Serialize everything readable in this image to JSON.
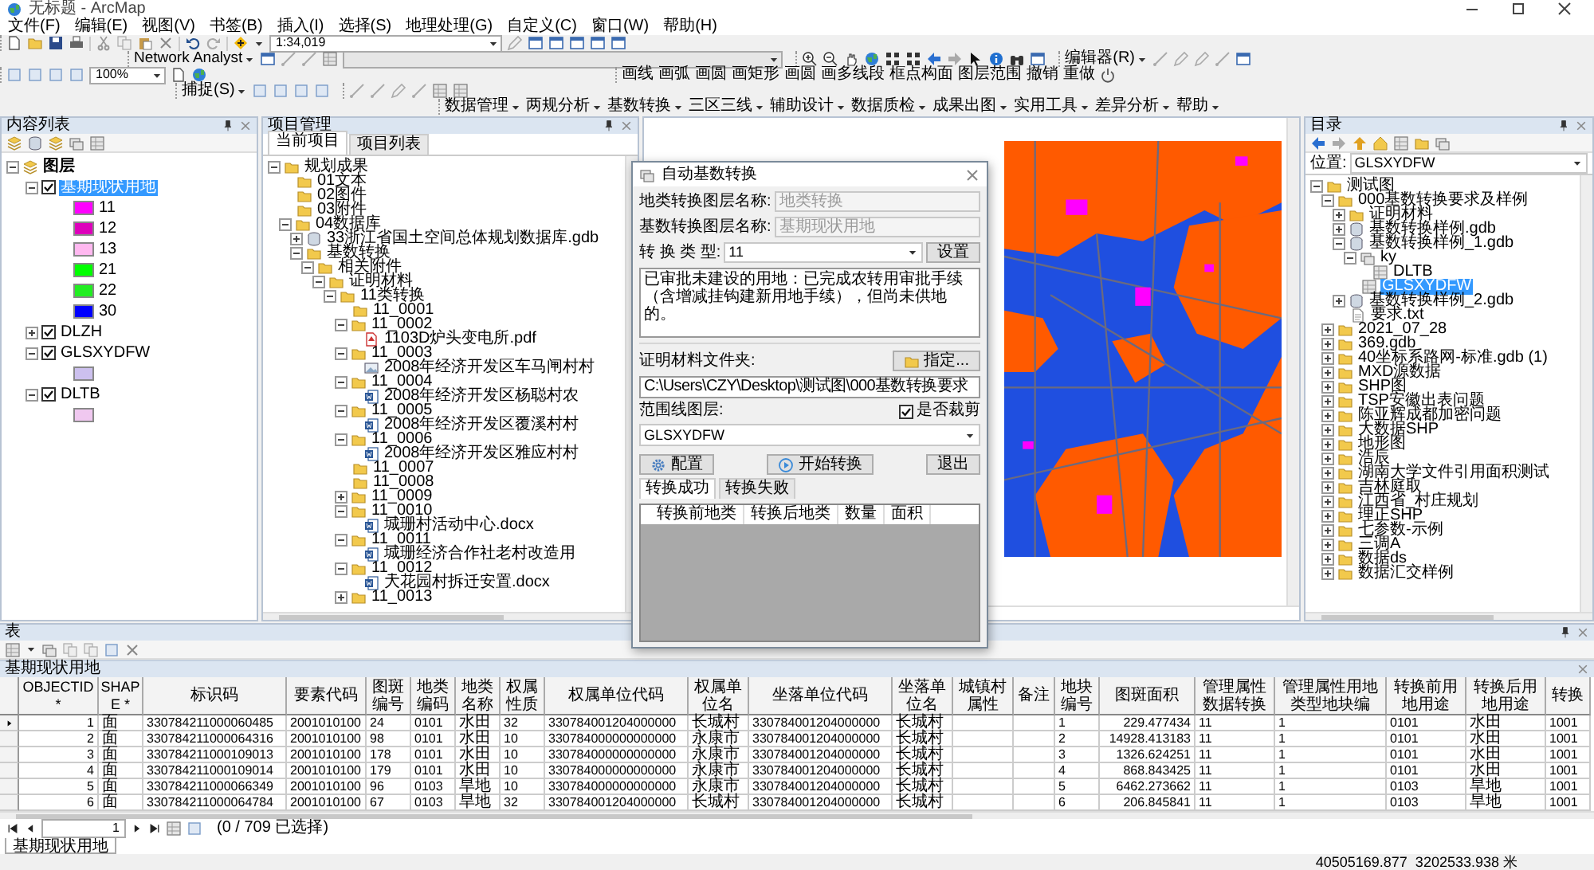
{
  "window": {
    "title": "无标题 - ArcMap"
  },
  "menu": [
    "文件(F)",
    "编辑(E)",
    "视图(V)",
    "书签(B)",
    "插入(I)",
    "选择(S)",
    "地理处理(G)",
    "自定义(C)",
    "窗口(W)",
    "帮助(H)"
  ],
  "toolbars": {
    "scale": "1:34,019",
    "network_analyst": "Network Analyst",
    "editor": "编辑器(R)",
    "zoom_percent": "100%",
    "snapping": "捕捉(S)",
    "draw_tools": [
      "画线",
      "画弧",
      "画圆",
      "画矩形",
      "画圆",
      "画多线段",
      "框点构面",
      "图层范围",
      "撤销",
      "重做"
    ],
    "plugin_menus": [
      "数据管理",
      "两规分析",
      "基数转换",
      "三区三线",
      "辅助设计",
      "数据质检",
      "成果出图",
      "实用工具",
      "差异分析",
      "帮助"
    ]
  },
  "toc": {
    "title": "内容列表",
    "layers": [
      {
        "label": "图层",
        "kind": "group",
        "expanded": true,
        "children": [
          {
            "label": "基期现状用地",
            "checked": true,
            "selected": true,
            "expanded": true,
            "legend": [
              {
                "label": "11",
                "color": "#ff00ff"
              },
              {
                "label": "12",
                "color": "#dd00bb"
              },
              {
                "label": "13",
                "color": "#ffb8f0"
              },
              {
                "label": "21",
                "color": "#00ff00"
              },
              {
                "label": "22",
                "color": "#22ee22"
              },
              {
                "label": "30",
                "color": "#0000ff"
              }
            ]
          },
          {
            "label": "DLZH",
            "checked": true,
            "selected": false,
            "expanded": false
          },
          {
            "label": "GLSXYDFW",
            "checked": true,
            "selected": false,
            "expanded": true,
            "legend": [
              {
                "color": "#ccc0ee"
              }
            ]
          },
          {
            "label": "DLTB",
            "checked": true,
            "selected": false,
            "expanded": true,
            "legend": [
              {
                "color": "#f0c8f0"
              }
            ]
          }
        ]
      }
    ]
  },
  "project": {
    "title": "项目管理",
    "tabs": [
      {
        "label": "当前项目",
        "selected": true
      },
      {
        "label": "项目列表",
        "selected": false
      }
    ],
    "tree": [
      {
        "label": "规划成果",
        "kind": "folder",
        "expanded": true,
        "children": [
          {
            "label": "01文本",
            "kind": "folder"
          },
          {
            "label": "02图件",
            "kind": "folder"
          },
          {
            "label": "03附件",
            "kind": "folder"
          },
          {
            "label": "04数据库",
            "kind": "folder",
            "expanded": true,
            "children": [
              {
                "label": "33浙江省国土空间总体规划数据库.gdb",
                "kind": "gdb",
                "expanded": false
              },
              {
                "label": "基数转换",
                "kind": "folder",
                "expanded": true,
                "children": [
                  {
                    "label": "相关附件",
                    "kind": "folder",
                    "expanded": true,
                    "children": [
                      {
                        "label": "证明材料",
                        "kind": "folder",
                        "expanded": true,
                        "children": [
                          {
                            "label": "11类转换",
                            "kind": "folder",
                            "expanded": true,
                            "children": [
                              {
                                "label": "11_0001",
                                "kind": "folder"
                              },
                              {
                                "label": "11_0002",
                                "kind": "folder",
                                "expanded": true,
                                "children": [
                                  {
                                    "label": "1103D炉头变电所.pdf",
                                    "kind": "pdf"
                                  }
                                ]
                              },
                              {
                                "label": "11_0003",
                                "kind": "folder",
                                "expanded": true,
                                "children": [
                                  {
                                    "label": "2008年经济开发区车马闸村村",
                                    "kind": "image"
                                  }
                                ]
                              },
                              {
                                "label": "11_0004",
                                "kind": "folder",
                                "expanded": true,
                                "children": [
                                  {
                                    "label": "2008年经济开发区杨聪村农",
                                    "kind": "docx"
                                  }
                                ]
                              },
                              {
                                "label": "11_0005",
                                "kind": "folder",
                                "expanded": true,
                                "children": [
                                  {
                                    "label": "2008年经济开发区覆溪村村",
                                    "kind": "docx"
                                  }
                                ]
                              },
                              {
                                "label": "11_0006",
                                "kind": "folder",
                                "expanded": true,
                                "children": [
                                  {
                                    "label": "2008年经济开发区雅应村村",
                                    "kind": "docx"
                                  }
                                ]
                              },
                              {
                                "label": "11_0007",
                                "kind": "folder"
                              },
                              {
                                "label": "11_0008",
                                "kind": "folder"
                              },
                              {
                                "label": "11_0009",
                                "kind": "folder",
                                "expanded": false
                              },
                              {
                                "label": "11_0010",
                                "kind": "folder",
                                "expanded": true,
                                "children": [
                                  {
                                    "label": "城珊村活动中心.docx",
                                    "kind": "docx"
                                  }
                                ]
                              },
                              {
                                "label": "11_0011",
                                "kind": "folder",
                                "expanded": true,
                                "children": [
                                  {
                                    "label": "城珊经济合作社老村改造用",
                                    "kind": "docx"
                                  }
                                ]
                              },
                              {
                                "label": "11_0012",
                                "kind": "folder",
                                "expanded": true,
                                "children": [
                                  {
                                    "label": "大花园村拆迁安置.docx",
                                    "kind": "docx"
                                  }
                                ]
                              },
                              {
                                "label": "11_0013",
                                "kind": "folder",
                                "expanded": false
                              }
                            ]
                          }
                        ]
                      }
                    ]
                  }
                ]
              }
            ]
          }
        ]
      }
    ]
  },
  "dialog": {
    "title": "自动基数转换",
    "fields": [
      {
        "label": "地类转换图层名称:",
        "value": "地类转换",
        "disabled": true
      },
      {
        "label": "基数转换图层名称:",
        "value": "基期现状用地",
        "disabled": true
      }
    ],
    "type_label": "转 换 类 型:",
    "type_value": "11",
    "settings_button": "设置",
    "description": "已审批未建设的用地：已完成农转用审批手续（含增减挂钩建新用地手续），但尚未供地的。",
    "evidence_label": "证明材料文件夹:",
    "browse_button": "指定...",
    "evidence_path": "C:\\Users\\CZY\\Desktop\\测试图\\000基数转换要求",
    "extent_label": "范围线图层:",
    "clip": {
      "label": "是否裁剪",
      "checked": true
    },
    "extent_layer": "GLSXYDFW",
    "buttons": [
      {
        "label": "配置",
        "kind": "config"
      },
      {
        "label": "开始转换",
        "kind": "start"
      },
      {
        "label": "退出",
        "kind": "exit"
      }
    ],
    "tabs": [
      {
        "label": "转换成功",
        "selected": true
      },
      {
        "label": "转换失败",
        "selected": false
      }
    ],
    "grid_columns": [
      "转换前地类",
      "转换后地类",
      "数量",
      "面积"
    ]
  },
  "catalog": {
    "title": "目录",
    "location_label": "位置:",
    "location": "GLSXYDFW",
    "tree": [
      {
        "label": "测试图",
        "kind": "folder",
        "expanded": true,
        "selected": false,
        "children": [
          {
            "label": "000基数转换要求及样例",
            "kind": "folder",
            "expanded": true,
            "selected": false,
            "children": [
              {
                "label": "证明材料",
                "kind": "folder",
                "expanded": false,
                "selected": false
              },
              {
                "label": "基数转换样例.gdb",
                "kind": "gdb",
                "expanded": false,
                "selected": false
              },
              {
                "label": "基数转换样例_1.gdb",
                "kind": "gdb",
                "expanded": true,
                "selected": false,
                "children": [
                  {
                    "label": "ky",
                    "kind": "dataset",
                    "expanded": true,
                    "selected": false,
                    "children": [
                      {
                        "label": "DLTB",
                        "kind": "featureclass",
                        "selected": false
                      }
                    ]
                  },
                  {
                    "label": "GLSXYDFW",
                    "kind": "featureclass",
                    "selected": true
                  }
                ]
              },
              {
                "label": "基数转换样例_2.gdb",
                "kind": "gdb",
                "expanded": false,
                "selected": false
              },
              {
                "label": "要求.txt",
                "kind": "txt",
                "selected": false
              }
            ]
          },
          {
            "label": "2021_07_28",
            "kind": "folder",
            "expanded": false,
            "selected": false
          },
          {
            "label": "369.gdb",
            "kind": "folder",
            "expanded": false,
            "selected": false
          },
          {
            "label": "40坐标系路网-标准.gdb (1)",
            "kind": "folder",
            "expanded": false,
            "selected": false
          },
          {
            "label": "MXD源数据",
            "kind": "folder",
            "expanded": false,
            "selected": false
          },
          {
            "label": "SHP图",
            "kind": "folder",
            "expanded": false,
            "selected": false
          },
          {
            "label": "TSP安徽出表问题",
            "kind": "folder",
            "expanded": false,
            "selected": false
          },
          {
            "label": "陈亚辉成都加密问题",
            "kind": "folder",
            "expanded": false,
            "selected": false
          },
          {
            "label": "大数据SHP",
            "kind": "folder",
            "expanded": false,
            "selected": false
          },
          {
            "label": "地形图",
            "kind": "folder",
            "expanded": false,
            "selected": false
          },
          {
            "label": "浩辰",
            "kind": "folder",
            "expanded": false,
            "selected": false
          },
          {
            "label": "湖南大学文件引用面积测试",
            "kind": "folder",
            "expanded": false,
            "selected": false
          },
          {
            "label": "吉林庭取",
            "kind": "folder",
            "expanded": false,
            "selected": false
          },
          {
            "label": "江西省_村庄规划",
            "kind": "folder",
            "expanded": false,
            "selected": false
          },
          {
            "label": "理正SHP",
            "kind": "folder",
            "expanded": false,
            "selected": false
          },
          {
            "label": "七参数-示例",
            "kind": "folder",
            "expanded": false,
            "selected": false
          },
          {
            "label": "三调A",
            "kind": "folder",
            "expanded": false,
            "selected": false
          },
          {
            "label": "数据ds",
            "kind": "folder",
            "expanded": false,
            "selected": false
          },
          {
            "label": "数据汇交样例",
            "kind": "folder",
            "expanded": false,
            "selected": false
          }
        ]
      }
    ]
  },
  "table": {
    "title": "表",
    "layer_tab": "基期现状用地",
    "columns": [
      "OBJECTID *",
      "SHAPE *",
      "标识码",
      "要素代码",
      "图斑编号",
      "地类编码",
      "地类名称",
      "权属性质",
      "权属单位代码",
      "权属单位名",
      "坐落单位代码",
      "坐落单位名",
      "城镇村属性",
      "备注",
      "地块编号",
      "图斑面积",
      "管理属性数据转换",
      "管理属性用地类型地块编",
      "转换前用地用途",
      "转换后用地用途",
      "转换"
    ],
    "rows": [
      {
        "current": true,
        "cells": [
          "1",
          "面",
          "330784211000060485",
          "2001010100",
          "24",
          "0101",
          "水田",
          "32",
          "330784001204000000",
          "长城村",
          "330784001204000000",
          "长城村",
          null,
          null,
          "1",
          "229.477434",
          "11",
          "1",
          "0101",
          "水田",
          "1001"
        ]
      },
      {
        "current": false,
        "cells": [
          "2",
          "面",
          "330784211000064316",
          "2001010100",
          "98",
          "0101",
          "水田",
          "10",
          "330784000000000000",
          "永康市",
          "330784001204000000",
          "长城村",
          null,
          null,
          "2",
          "14928.413183",
          "11",
          "1",
          "0101",
          "水田",
          "1001"
        ]
      },
      {
        "current": false,
        "cells": [
          "3",
          "面",
          "330784211000109013",
          "2001010100",
          "178",
          "0101",
          "水田",
          "10",
          "330784000000000000",
          "永康市",
          "330784001204000000",
          "长城村",
          null,
          null,
          "3",
          "1326.624251",
          "11",
          "1",
          "0101",
          "水田",
          "1001"
        ]
      },
      {
        "current": false,
        "cells": [
          "4",
          "面",
          "330784211000109014",
          "2001010100",
          "179",
          "0101",
          "水田",
          "10",
          "330784000000000000",
          "永康市",
          "330784001204000000",
          "长城村",
          null,
          null,
          "4",
          "868.843425",
          "11",
          "1",
          "0101",
          "水田",
          "1001"
        ]
      },
      {
        "current": false,
        "cells": [
          "5",
          "面",
          "330784211000066349",
          "2001010100",
          "96",
          "0103",
          "旱地",
          "10",
          "330784000000000000",
          "永康市",
          "330784001204000000",
          "长城村",
          null,
          null,
          "5",
          "6462.273662",
          "11",
          "1",
          "0103",
          "旱地",
          "1001"
        ]
      },
      {
        "current": false,
        "cells": [
          "6",
          "面",
          "330784211000064784",
          "2001010100",
          "67",
          "0103",
          "旱地",
          "32",
          "330784001204000000",
          "长城村",
          "330784001204000000",
          "长城村",
          null,
          null,
          "6",
          "206.845841",
          "11",
          "1",
          "0103",
          "旱地",
          "1001"
        ]
      }
    ],
    "record": "1",
    "selection": "(0 / 709 已选择)",
    "bottom_tab": "基期现状用地"
  },
  "status_bar": {
    "coordinates": "40505169.877  3202533.938 米"
  }
}
